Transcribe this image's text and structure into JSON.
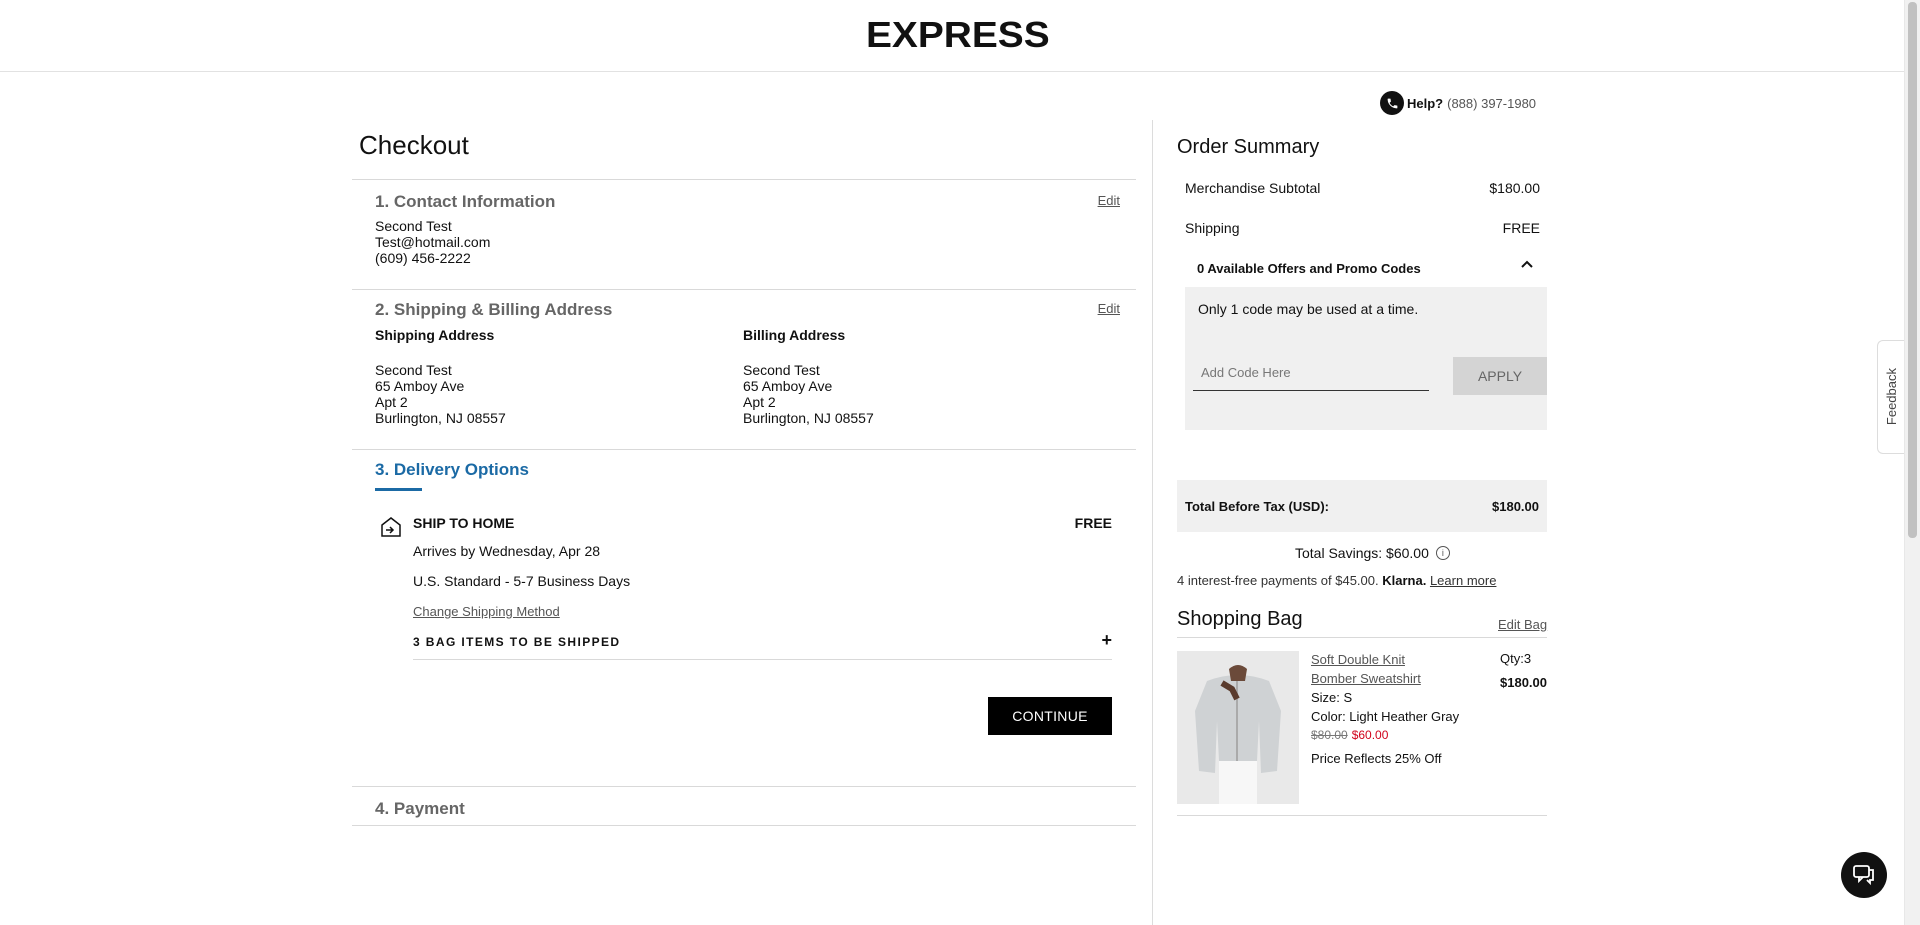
{
  "brand": {
    "logo": "EXPRESS"
  },
  "help": {
    "label": "Help?",
    "phone": "(888) 397-1980",
    "icon": "phone-icon"
  },
  "checkout": {
    "title": "Checkout",
    "contact": {
      "title": "1. Contact Information",
      "edit": "Edit",
      "name": "Second Test",
      "email": "Test@hotmail.com",
      "phone": "(609) 456-2222"
    },
    "address": {
      "title": "2. Shipping & Billing Address",
      "edit": "Edit",
      "shipping": {
        "heading": "Shipping Address",
        "name": "Second Test",
        "street": "65 Amboy Ave",
        "apt": "Apt 2",
        "city": "Burlington, NJ 08557"
      },
      "billing": {
        "heading": "Billing Address",
        "name": "Second Test",
        "street": "65 Amboy Ave",
        "apt": "Apt 2",
        "city": "Burlington, NJ 08557"
      }
    },
    "delivery": {
      "title": "3. Delivery Options",
      "method": "SHIP TO HOME",
      "price": "FREE",
      "arrival": "Arrives by Wednesday, Apr 28",
      "service": "U.S. Standard - 5-7 Business Days",
      "change": "Change Shipping Method",
      "bag_items": "3 BAG ITEMS TO BE SHIPPED",
      "expand": "+",
      "continue": "CONTINUE"
    },
    "payment": {
      "title": "4. Payment"
    }
  },
  "summary": {
    "title": "Order Summary",
    "subtotal_label": "Merchandise Subtotal",
    "subtotal": "$180.00",
    "shipping_label": "Shipping",
    "shipping": "FREE",
    "offers_title": "0 Available Offers and Promo Codes",
    "offers_note": "Only 1 code may be used at a time.",
    "promo_placeholder": "Add Code Here",
    "apply": "APPLY",
    "total_label": "Total Before Tax (USD):",
    "total": "$180.00",
    "savings": "Total Savings: $60.00",
    "klarna_text": "4 interest-free payments of $45.00.",
    "klarna_brand": "Klarna.",
    "klarna_learn": "Learn more"
  },
  "bag": {
    "title": "Shopping Bag",
    "edit": "Edit Bag",
    "item": {
      "name_line1": "Soft Double Knit",
      "name_line2": "Bomber Sweatshirt",
      "size": "Size: S",
      "color": "Color: Light Heather Gray",
      "original_price": "$80.00",
      "sale_price": "$60.00",
      "discount": "Price Reflects 25% Off",
      "qty": "Qty:3",
      "total": "$180.00"
    }
  },
  "widgets": {
    "feedback": "Feedback"
  }
}
